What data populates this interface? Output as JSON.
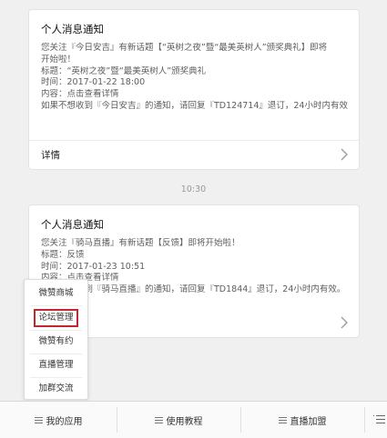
{
  "card1": {
    "title": "个人消息通知",
    "lines": [
      "您关注『今日安吉』有新话题【“英树之夜”暨“最美英树人”颁奖典礼】即将",
      "开始啦！",
      "标题：“英树之夜”暨“最美英树人”颁奖典礼",
      "时间：2017-01-22 18:00",
      "内容：点击查看详情",
      "如果不想收到『今日安吉』的通知，请回复『TD124714』退订，24小时内有效。"
    ],
    "detail_label": "详情"
  },
  "time_separator": "10:30",
  "card2": {
    "title": "个人消息通知",
    "lines": [
      "您关注『骑马直播』有新话题【反馈】即将开始啦！",
      "标题：反馈",
      "时间：2017-01-23 10:51",
      "内容：点击查看详情",
      "如果不想收到『骑马直播』的通知，请回复『TD1844』退订，24小时内有效。"
    ]
  },
  "popup_menu": {
    "items": [
      "微赞商城",
      "论坛管理",
      "微赞有约",
      "直播管理",
      "加群交流"
    ],
    "highlighted_index": 1,
    "highlight_color": "#c0282b"
  },
  "bottom_bar": {
    "tabs": [
      "我的应用",
      "使用教程",
      "直播加盟"
    ]
  }
}
